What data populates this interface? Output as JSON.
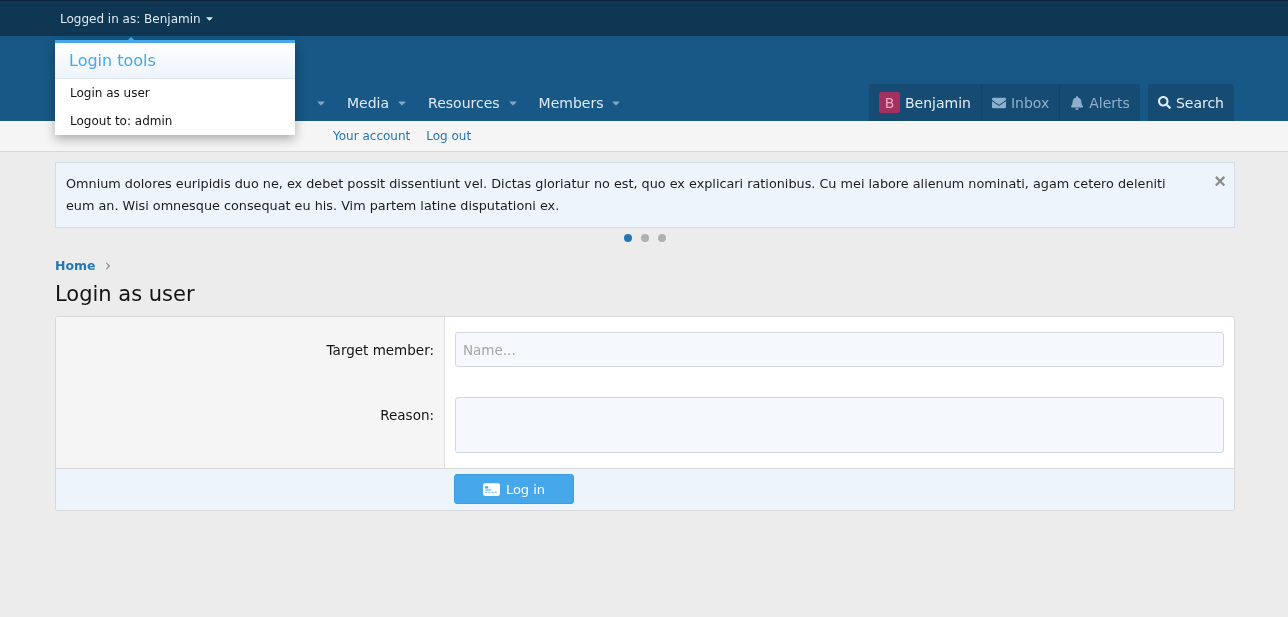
{
  "top_bar": {
    "logged_in_label": "Logged in as: Benjamin"
  },
  "login_tools_menu": {
    "title": "Login tools",
    "items": [
      {
        "label": "Login as user"
      },
      {
        "label": "Logout to: admin"
      }
    ]
  },
  "nav": {
    "items": [
      {
        "has_menu": true
      },
      {
        "label": "Media",
        "has_menu": true
      },
      {
        "label": "Resources",
        "has_menu": true
      },
      {
        "label": "Members",
        "has_menu": true
      }
    ],
    "user": {
      "initial": "B",
      "name": "Benjamin"
    },
    "actions": [
      {
        "kind": "inbox",
        "label": "Inbox"
      },
      {
        "kind": "alerts",
        "label": "Alerts"
      }
    ],
    "search": {
      "label": "Search"
    }
  },
  "sub_nav": {
    "items": [
      {
        "label": "Your account"
      },
      {
        "label": "Log out"
      }
    ]
  },
  "notice": {
    "text": "Omnium dolores euripidis duo ne, ex debet possit dissentiunt vel. Dictas gloriatur no est, quo ex explicari rationibus. Cu mei labore alienum nominati, agam cetero deleniti eum an. Wisi omnesque consequat eu his. Vim partem latine disputationi ex.",
    "close": "×",
    "dots": [
      {
        "selected": true
      },
      {
        "selected": false
      },
      {
        "selected": false
      }
    ]
  },
  "breadcrumb": [
    {
      "label": "Home"
    }
  ],
  "page_title": "Login as user",
  "form": {
    "rows": [
      {
        "kind": "input",
        "label": "Target member:",
        "placeholder": "Name..."
      },
      {
        "kind": "textarea",
        "label": "Reason:"
      }
    ],
    "submit": {
      "label": "Log in"
    }
  }
}
